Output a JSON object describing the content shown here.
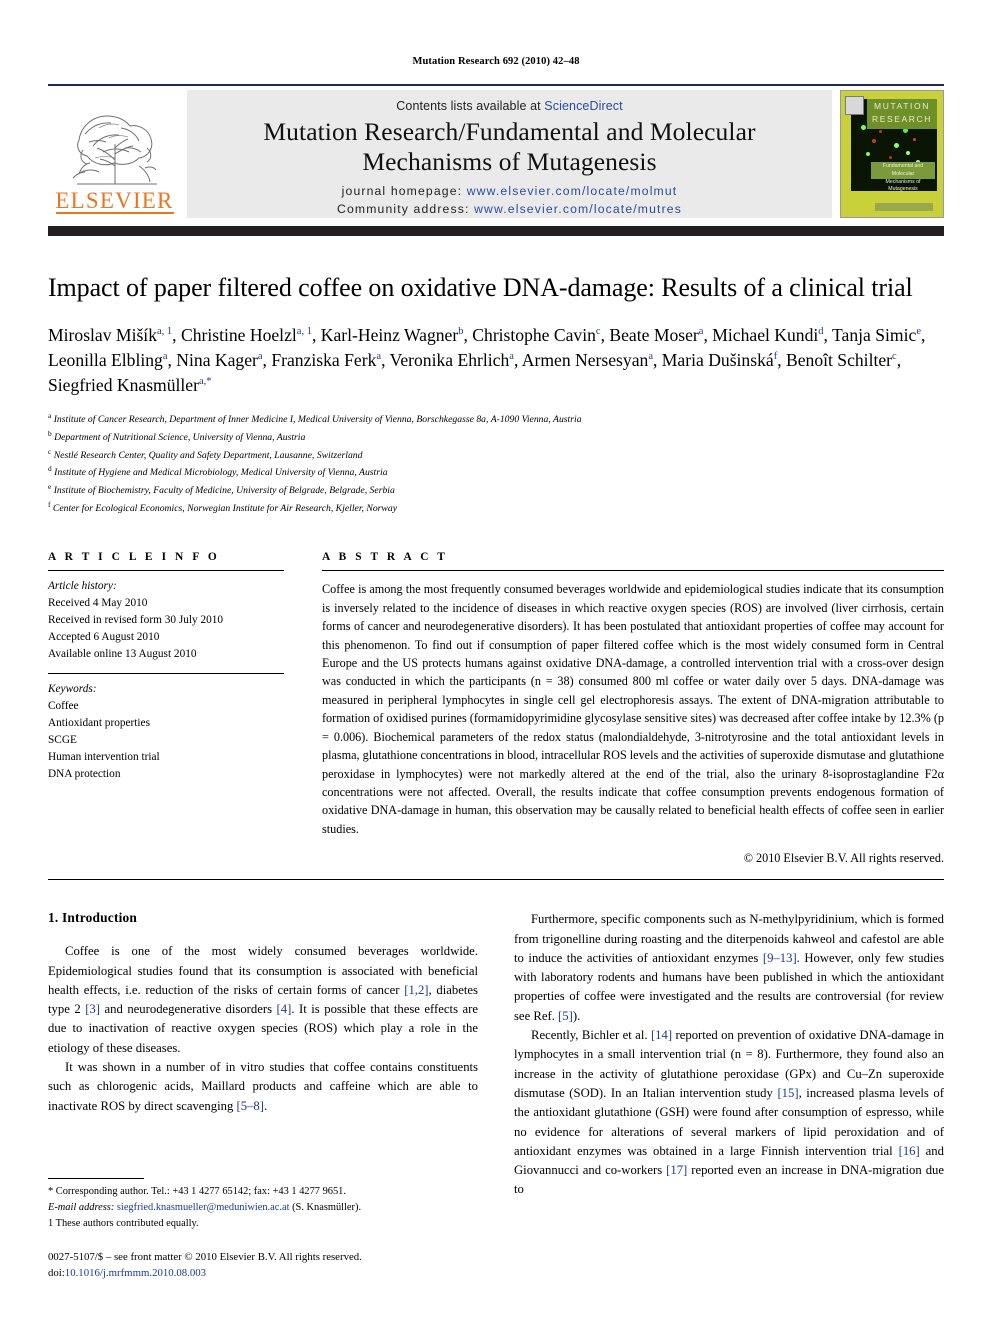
{
  "running_head": "Mutation Research 692 (2010) 42–48",
  "masthead": {
    "contents_prefix": "Contents lists available at",
    "sciencedirect": "ScienceDirect",
    "journal_title_line1": "Mutation Research/Fundamental and Molecular",
    "journal_title_line2": "Mechanisms of Mutagenesis",
    "homepage_label": "journal homepage:",
    "homepage_url": "www.elsevier.com/locate/molmut",
    "community_label": "Community address:",
    "community_url": "www.elsevier.com/locate/mutres",
    "publisher_name": "ELSEVIER",
    "cover_title_line1": "MUTATION",
    "cover_title_line2": "RESEARCH",
    "cover_sub_line1": "Fundamental and Molecular",
    "cover_sub_line2": "Mechanisms of Mutagenesis"
  },
  "article": {
    "title": "Impact of paper filtered coffee on oxidative DNA-damage: Results of a clinical trial",
    "authors_line1": "Miroslav Mišík",
    "authors_html_note": "rendered with superscript affiliation markers",
    "authors": [
      {
        "name": "Miroslav Mišík",
        "sup": "a, 1"
      },
      {
        "name": "Christine Hoelzl",
        "sup": "a, 1"
      },
      {
        "name": "Karl-Heinz Wagner",
        "sup": "b"
      },
      {
        "name": "Christophe Cavin",
        "sup": "c"
      },
      {
        "name": "Beate Moser",
        "sup": "a"
      },
      {
        "name": "Michael Kundi",
        "sup": "d"
      },
      {
        "name": "Tanja Simic",
        "sup": "e"
      },
      {
        "name": "Leonilla Elbling",
        "sup": "a"
      },
      {
        "name": "Nina Kager",
        "sup": "a"
      },
      {
        "name": "Franziska Ferk",
        "sup": "a"
      },
      {
        "name": "Veronika Ehrlich",
        "sup": "a"
      },
      {
        "name": "Armen Nersesyan",
        "sup": "a"
      },
      {
        "name": "Maria Dušinská",
        "sup": "f"
      },
      {
        "name": "Benoît Schilter",
        "sup": "c"
      },
      {
        "name": "Siegfried Knasmüller",
        "sup": "a,*"
      }
    ],
    "affiliations": [
      {
        "marker": "a",
        "text": "Institute of Cancer Research, Department of Inner Medicine I, Medical University of Vienna, Borschkegasse 8a, A-1090 Vienna, Austria"
      },
      {
        "marker": "b",
        "text": "Department of Nutritional Science, University of Vienna, Austria"
      },
      {
        "marker": "c",
        "text": "Nestlé Research Center, Quality and Safety Department, Lausanne, Switzerland"
      },
      {
        "marker": "d",
        "text": "Institute of Hygiene and Medical Microbiology, Medical University of Vienna, Austria"
      },
      {
        "marker": "e",
        "text": "Institute of Biochemistry, Faculty of Medicine, University of Belgrade, Belgrade, Serbia"
      },
      {
        "marker": "f",
        "text": "Center for Ecological Economics, Norwegian Institute for Air Research, Kjeller, Norway"
      }
    ]
  },
  "article_info": {
    "label": "A R T I C L E   I N F O",
    "history_heading": "Article history:",
    "history": [
      "Received 4 May 2010",
      "Received in revised form 30 July 2010",
      "Accepted 6 August 2010",
      "Available online 13 August 2010"
    ],
    "keywords_heading": "Keywords:",
    "keywords": [
      "Coffee",
      "Antioxidant properties",
      "SCGE",
      "Human intervention trial",
      "DNA protection"
    ]
  },
  "abstract": {
    "label": "A B S T R A C T",
    "text": "Coffee is among the most frequently consumed beverages worldwide and epidemiological studies indicate that its consumption is inversely related to the incidence of diseases in which reactive oxygen species (ROS) are involved (liver cirrhosis, certain forms of cancer and neurodegenerative disorders). It has been postulated that antioxidant properties of coffee may account for this phenomenon. To find out if consumption of paper filtered coffee which is the most widely consumed form in Central Europe and the US protects humans against oxidative DNA-damage, a controlled intervention trial with a cross-over design was conducted in which the participants (n = 38) consumed 800 ml coffee or water daily over 5 days. DNA-damage was measured in peripheral lymphocytes in single cell gel electrophoresis assays. The extent of DNA-migration attributable to formation of oxidised purines (formamidopyrimidine glycosylase sensitive sites) was decreased after coffee intake by 12.3% (p = 0.006). Biochemical parameters of the redox status (malondialdehyde, 3-nitrotyrosine and the total antioxidant levels in plasma, glutathione concentrations in blood, intracellular ROS levels and the activities of superoxide dismutase and glutathione peroxidase in lymphocytes) were not markedly altered at the end of the trial, also the urinary 8-isoprostaglandine F2α concentrations were not affected. Overall, the results indicate that coffee consumption prevents endogenous formation of oxidative DNA-damage in human, this observation may be causally related to beneficial health effects of coffee seen in earlier studies.",
    "copyright": "© 2010 Elsevier B.V. All rights reserved."
  },
  "introduction": {
    "heading": "1.  Introduction",
    "left_paragraphs": [
      "Coffee is one of the most widely consumed beverages worldwide. Epidemiological studies found that its consumption is associated with beneficial health effects, i.e. reduction of the risks of certain forms of cancer [1,2], diabetes type 2 [3] and neurodegenerative disorders [4]. It is possible that these effects are due to inactivation of reactive oxygen species (ROS) which play a role in the etiology of these diseases.",
      "It was shown in a number of in vitro studies that coffee contains constituents such as chlorogenic acids, Maillard products and caffeine which are able to inactivate ROS by direct scavenging [5–8]."
    ],
    "right_paragraphs": [
      "Furthermore, specific components such as N-methylpyridinium, which is formed from trigonelline during roasting and the diterpenoids kahweol and cafestol are able to induce the activities of antioxidant enzymes [9–13]. However, only few studies with laboratory rodents and humans have been published in which the antioxidant properties of coffee were investigated and the results are controversial (for review see Ref. [5]).",
      "Recently, Bichler et al. [14] reported on prevention of oxidative DNA-damage in lymphocytes in a small intervention trial (n = 8). Furthermore, they found also an increase in the activity of glutathione peroxidase (GPx) and Cu–Zn superoxide dismutase (SOD). In an Italian intervention study [15], increased plasma levels of the antioxidant glutathione (GSH) were found after consumption of espresso, while no evidence for alterations of several markers of lipid peroxidation and of antioxidant enzymes was obtained in a large Finnish intervention trial [16] and Giovannucci and co-workers [17] reported even an increase in DNA-migration due to"
    ]
  },
  "footnotes": {
    "corresponding": "* Corresponding author. Tel.: +43 1 4277 65142; fax: +43 1 4277 9651.",
    "email_label": "E-mail address:",
    "email": "siegfried.knasmueller@meduniwien.ac.at",
    "email_suffix": "(S. Knasmüller).",
    "equal_contrib": "1  These authors contributed equally.",
    "imprint": "0027-5107/$ – see front matter © 2010 Elsevier B.V. All rights reserved.",
    "doi_label": "doi:",
    "doi": "10.1016/j.mrfmmm.2010.08.003"
  },
  "colors": {
    "link": "#2b4c9b",
    "reference": "#1b3a8c",
    "elsevier_orange": "#E87722",
    "masthead_rule": "#1a2a5e",
    "band_gray": "#eaeaea",
    "black_bar": "#231f20",
    "cover_green": "#c9d13a"
  }
}
